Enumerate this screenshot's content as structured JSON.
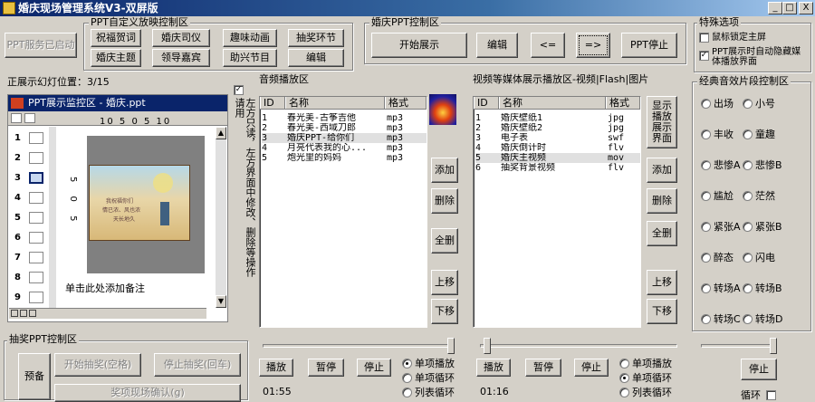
{
  "window": {
    "title": "婚庆现场管理系统V3-双屏版"
  },
  "titlebar_buttons": {
    "min": "_",
    "max": "□",
    "close": "X"
  },
  "ppt_service_btn": "PPT服务已启动",
  "ppt_custom": {
    "title": "PPT自定义放映控制区",
    "buttons": [
      "祝福贺词",
      "婚庆司仪",
      "趣味动画",
      "抽奖环节",
      "婚庆主题",
      "领导嘉宾",
      "助兴节目",
      "编辑"
    ]
  },
  "celebration": {
    "title": "婚庆PPT控制区",
    "start": "开始展示",
    "edit": "编辑",
    "prev": "<=",
    "next": "=>",
    "stop": "PPT停止"
  },
  "special": {
    "title": "特殊选项",
    "opt1": "鼠标锁定主屏",
    "opt2": "PPT展示时自动隐藏媒体播放界面"
  },
  "slide_pos": "正展示幻灯位置：3/15",
  "ppt_monitor": {
    "title": "PPT展示监控区 - 婚庆.ppt",
    "ruler_h": "10 5 0 5 10",
    "ruler_v": "5 0 5",
    "vertical_hint": "左方只读，左方界面中修改、删除等操作请用",
    "notes": "单击此处添加备注",
    "slides": [
      "1",
      "2",
      "3",
      "4",
      "5",
      "6",
      "7",
      "8",
      "9"
    ]
  },
  "slide_thumb_text": [
    "我祝福你们",
    "情已浓、风也浓",
    "天长地久"
  ],
  "audio": {
    "title": "音频播放区",
    "columns": [
      "ID",
      "名称",
      "格式"
    ],
    "rows": [
      [
        "1",
        "春光美-古筝吉他",
        "mp3"
      ],
      [
        "2",
        "春光美-西域刀郎",
        "mp3"
      ],
      [
        "3",
        "婚庆PPT-给你们",
        "mp3"
      ],
      [
        "4",
        "月亮代表我的心...",
        "mp3"
      ],
      [
        "5",
        "炮光里的妈妈",
        "mp3"
      ]
    ],
    "selected": 2,
    "add": "添加",
    "del": "删除",
    "all": "全删",
    "up": "上移",
    "down": "下移",
    "play": "播放",
    "pause": "暂停",
    "stop": "停止",
    "mode1": "单项播放",
    "mode2": "单项循环",
    "mode3": "列表循环",
    "time": "01:55"
  },
  "video": {
    "title": "视频等媒体展示播放区-视频|Flash|图片",
    "columns": [
      "ID",
      "名称",
      "格式"
    ],
    "rows": [
      [
        "1",
        "婚庆壁纸1",
        "jpg"
      ],
      [
        "2",
        "婚庆壁纸2",
        "jpg"
      ],
      [
        "3",
        "电子表",
        "swf"
      ],
      [
        "4",
        "婚庆倒计时",
        "flv"
      ],
      [
        "5",
        "婚庆主视频",
        "mov"
      ],
      [
        "6",
        "抽奖背景视频",
        "flv"
      ]
    ],
    "selected": 4,
    "show": "显示播放展示界面",
    "add": "添加",
    "del": "删除",
    "all": "全删",
    "up": "上移",
    "down": "下移",
    "play": "播放",
    "pause": "暂停",
    "stop": "停止",
    "mode1": "单项播放",
    "mode2": "单项循环",
    "mode3": "列表循环",
    "time": "01:16"
  },
  "effects": {
    "title": "经典音效片段控制区",
    "items": [
      [
        "出场",
        "小号"
      ],
      [
        "丰收",
        "童趣"
      ],
      [
        "悲惨A",
        "悲惨B"
      ],
      [
        "尴尬",
        "茫然"
      ],
      [
        "紧张A",
        "紧张B"
      ],
      [
        "醉态",
        "闪电"
      ],
      [
        "转场A",
        "转场B"
      ],
      [
        "转场C",
        "转场D"
      ]
    ],
    "stop": "停止",
    "loop": "循环"
  },
  "lottery": {
    "title": "抽奖PPT控制区",
    "prepare": "预备",
    "start": "开始抽奖(空格)",
    "stop": "停止抽奖(回车)",
    "confirm": "奖项现场确认(g)"
  },
  "colors": {
    "titlebar": "#0a246a",
    "selection": "#e0e0e0",
    "slide_bg": "#e8c868"
  }
}
